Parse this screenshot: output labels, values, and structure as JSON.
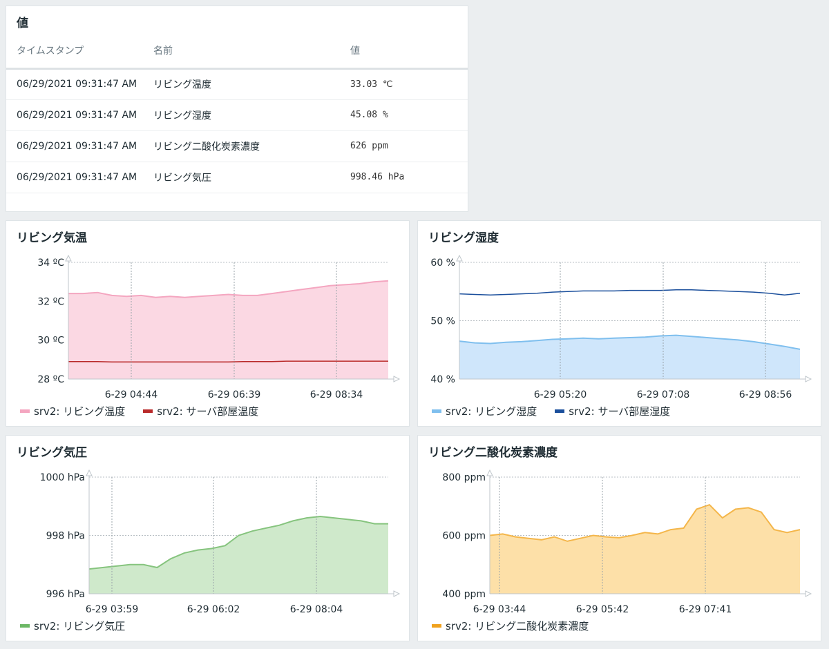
{
  "values_widget": {
    "title": "値",
    "headers": {
      "timestamp": "タイムスタンプ",
      "name": "名前",
      "value": "値"
    },
    "rows": [
      {
        "timestamp": "06/29/2021 09:31:47 AM",
        "name": "リビング温度",
        "value": "33.03 ℃"
      },
      {
        "timestamp": "06/29/2021 09:31:47 AM",
        "name": "リビング湿度",
        "value": "45.08 %"
      },
      {
        "timestamp": "06/29/2021 09:31:47 AM",
        "name": "リビング二酸化炭素濃度",
        "value": "626 ppm"
      },
      {
        "timestamp": "06/29/2021 09:31:47 AM",
        "name": "リビング気圧",
        "value": "998.46 hPa"
      }
    ]
  },
  "chart_data": [
    {
      "id": "temp",
      "type": "area",
      "title": "リビング気温",
      "y_ticks": [
        "34 ºC",
        "32 ºC",
        "30 ºC",
        "28 ºC"
      ],
      "ylim": [
        28,
        34
      ],
      "x_ticks": [
        "6-29 04:44",
        "6-29 06:39",
        "6-29 08:34"
      ],
      "series": [
        {
          "name": "srv2: リビング温度",
          "color": "#f4a6c0",
          "fill": "#fbd8e3",
          "filled": true,
          "values": [
            32.4,
            32.4,
            32.45,
            32.3,
            32.25,
            32.3,
            32.2,
            32.25,
            32.2,
            32.25,
            32.3,
            32.35,
            32.3,
            32.3,
            32.4,
            32.5,
            32.6,
            32.7,
            32.8,
            32.85,
            32.9,
            33.0,
            33.05
          ]
        },
        {
          "name": "srv2: サーバ部屋温度",
          "color": "#b92a2a",
          "fill": "none",
          "filled": false,
          "values": [
            28.9,
            28.9,
            28.9,
            28.88,
            28.88,
            28.88,
            28.88,
            28.88,
            28.88,
            28.88,
            28.88,
            28.88,
            28.9,
            28.9,
            28.9,
            28.92,
            28.92,
            28.92,
            28.92,
            28.92,
            28.92,
            28.92,
            28.92
          ]
        }
      ]
    },
    {
      "id": "hum",
      "type": "area",
      "title": "リビング湿度",
      "y_ticks": [
        "60 %",
        "50 %",
        "40 %"
      ],
      "ylim": [
        40,
        60
      ],
      "x_ticks": [
        "6-29 05:20",
        "6-29 07:08",
        "6-29 08:56"
      ],
      "series": [
        {
          "name": "srv2: リビング湿度",
          "color": "#7fbfee",
          "fill": "#cfe6fb",
          "filled": true,
          "values": [
            46.5,
            46.2,
            46.1,
            46.3,
            46.4,
            46.6,
            46.8,
            46.9,
            47.0,
            46.9,
            47.0,
            47.1,
            47.2,
            47.4,
            47.5,
            47.3,
            47.1,
            46.9,
            46.7,
            46.4,
            46.0,
            45.6,
            45.1
          ]
        },
        {
          "name": "srv2: サーバ部屋湿度",
          "color": "#1b4f9c",
          "fill": "none",
          "filled": false,
          "values": [
            54.6,
            54.5,
            54.4,
            54.5,
            54.6,
            54.7,
            54.9,
            55.0,
            55.1,
            55.1,
            55.1,
            55.2,
            55.2,
            55.2,
            55.3,
            55.3,
            55.2,
            55.1,
            55.0,
            54.9,
            54.7,
            54.4,
            54.7
          ]
        }
      ]
    },
    {
      "id": "pres",
      "type": "area",
      "title": "リビング気圧",
      "y_ticks": [
        "1000 hPa",
        "998 hPa",
        "996 hPa"
      ],
      "ylim": [
        996,
        1000
      ],
      "x_ticks": [
        "6-29 03:59",
        "6-29 06:02",
        "6-29 08:04"
      ],
      "series": [
        {
          "name": "srv2: リビング気圧",
          "color": "#86c47e",
          "fill": "#cfe9cb",
          "filled": true,
          "values": [
            996.85,
            996.9,
            996.95,
            997.0,
            997.0,
            996.9,
            997.2,
            997.4,
            997.5,
            997.55,
            997.65,
            998.0,
            998.15,
            998.25,
            998.35,
            998.5,
            998.6,
            998.65,
            998.6,
            998.55,
            998.5,
            998.4,
            998.4
          ]
        }
      ]
    },
    {
      "id": "co2",
      "type": "area",
      "title": "リビング二酸化炭素濃度",
      "y_ticks": [
        "800 ppm",
        "600 ppm",
        "400 ppm"
      ],
      "ylim": [
        400,
        800
      ],
      "x_ticks": [
        "6-29 03:44",
        "6-29 05:42",
        "6-29 07:41"
      ],
      "series": [
        {
          "name": "srv2: リビング二酸化炭素濃度",
          "color": "#f4b64a",
          "fill": "#fde0a8",
          "filled": true,
          "values": [
            600,
            605,
            595,
            590,
            585,
            595,
            580,
            590,
            600,
            595,
            592,
            600,
            610,
            605,
            620,
            625,
            690,
            705,
            660,
            690,
            695,
            680,
            620,
            610,
            620
          ]
        }
      ]
    }
  ]
}
